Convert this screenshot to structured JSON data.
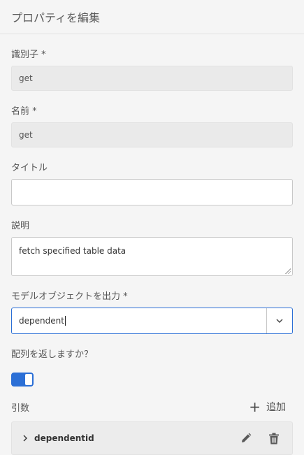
{
  "header": {
    "title": "プロパティを編集"
  },
  "fields": {
    "identifier": {
      "label": "識別子 *",
      "value": "get"
    },
    "name": {
      "label": "名前 *",
      "value": "get"
    },
    "title": {
      "label": "タイトル",
      "value": ""
    },
    "description": {
      "label": "説明",
      "value": "fetch specified table data"
    },
    "output_model": {
      "label": "モデルオブジェクトを出力 *",
      "value": "dependent"
    },
    "return_array": {
      "label": "配列を返しますか？",
      "checked": true
    }
  },
  "arguments": {
    "label": "引数",
    "add_label": "追加",
    "items": [
      {
        "name": "dependentid"
      }
    ]
  },
  "colors": {
    "accent": "#2b6fd6",
    "background": "#f5f5f5"
  },
  "icons": [
    "chevron-down-icon",
    "plus-icon",
    "chevron-right-icon",
    "pencil-icon",
    "trash-icon"
  ]
}
